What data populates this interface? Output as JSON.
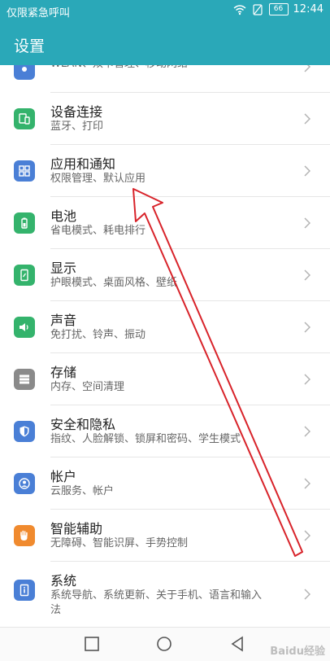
{
  "status_bar": {
    "carrier": "仅限紧急呼叫",
    "battery": "66",
    "time": "12:44"
  },
  "header": {
    "title": "设置"
  },
  "settings": [
    {
      "title": "",
      "subtitle": "WLAN、双卡管理、移动网络",
      "icon": "network-icon",
      "color": "#4a7fd6"
    },
    {
      "title": "设备连接",
      "subtitle": "蓝牙、打印",
      "icon": "device-connection-icon",
      "color": "#34b36c"
    },
    {
      "title": "应用和通知",
      "subtitle": "权限管理、默认应用",
      "icon": "apps-icon",
      "color": "#4a7fd6"
    },
    {
      "title": "电池",
      "subtitle": "省电模式、耗电排行",
      "icon": "battery-icon",
      "color": "#34b36c"
    },
    {
      "title": "显示",
      "subtitle": "护眼模式、桌面风格、壁纸",
      "icon": "display-icon",
      "color": "#34b36c"
    },
    {
      "title": "声音",
      "subtitle": "免打扰、铃声、振动",
      "icon": "sound-icon",
      "color": "#34b36c"
    },
    {
      "title": "存储",
      "subtitle": "内存、空间清理",
      "icon": "storage-icon",
      "color": "#8a8a8a"
    },
    {
      "title": "安全和隐私",
      "subtitle": "指纹、人脸解锁、锁屏和密码、学生模式",
      "icon": "security-shield-icon",
      "color": "#4a7fd6"
    },
    {
      "title": "帐户",
      "subtitle": "云服务、帐户",
      "icon": "account-icon",
      "color": "#4a7fd6"
    },
    {
      "title": "智能辅助",
      "subtitle": "无障碍、智能识屏、手势控制",
      "icon": "hand-assist-icon",
      "color": "#f08a2e"
    },
    {
      "title": "系统",
      "subtitle": "系统导航、系统更新、关于手机、语言和输入",
      "subtitle2": "法",
      "icon": "system-info-icon",
      "color": "#4a7fd6"
    }
  ],
  "colors": {
    "accent": "#2aa8b8",
    "annotation_arrow": "#d8232a"
  },
  "watermark": "Baidu经验"
}
